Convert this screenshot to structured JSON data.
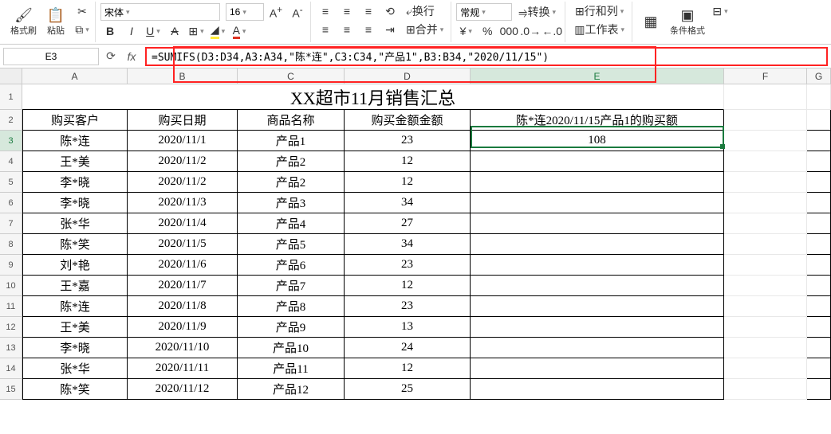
{
  "ribbon": {
    "format_painter": "格式刷",
    "paste": "粘贴",
    "font_name": "宋体",
    "font_size": "16",
    "wrap": "换行",
    "merge": "合并",
    "number_fmt": "常规",
    "convert": "转换",
    "rows_cols": "行和列",
    "worksheet": "工作表",
    "cond_fmt": "条件格式"
  },
  "formula_bar": {
    "cell_ref": "E3",
    "formula": "=SUMIFS(D3:D34,A3:A34,\"陈*连\",C3:C34,\"产品1\",B3:B34,\"2020/11/15\")"
  },
  "columns": [
    "A",
    "B",
    "C",
    "D",
    "E",
    "F",
    "G"
  ],
  "title": "XX超市11月销售汇总",
  "headers": [
    "购买客户",
    "购买日期",
    "商品名称",
    "购买金额金额",
    "陈*连2020/11/15产品1的购买额"
  ],
  "rows": [
    {
      "r": "1"
    },
    {
      "r": "2"
    },
    {
      "r": "3",
      "a": "陈*连",
      "b": "2020/11/1",
      "c": "产品1",
      "d": "23",
      "e": "108"
    },
    {
      "r": "4",
      "a": "王*美",
      "b": "2020/11/2",
      "c": "产品2",
      "d": "12",
      "e": ""
    },
    {
      "r": "5",
      "a": "李*晓",
      "b": "2020/11/2",
      "c": "产品2",
      "d": "12",
      "e": ""
    },
    {
      "r": "6",
      "a": "李*晓",
      "b": "2020/11/3",
      "c": "产品3",
      "d": "34",
      "e": ""
    },
    {
      "r": "7",
      "a": "张*华",
      "b": "2020/11/4",
      "c": "产品4",
      "d": "27",
      "e": ""
    },
    {
      "r": "8",
      "a": "陈*笑",
      "b": "2020/11/5",
      "c": "产品5",
      "d": "34",
      "e": ""
    },
    {
      "r": "9",
      "a": "刘*艳",
      "b": "2020/11/6",
      "c": "产品6",
      "d": "23",
      "e": ""
    },
    {
      "r": "10",
      "a": "王*嘉",
      "b": "2020/11/7",
      "c": "产品7",
      "d": "12",
      "e": ""
    },
    {
      "r": "11",
      "a": "陈*连",
      "b": "2020/11/8",
      "c": "产品8",
      "d": "23",
      "e": ""
    },
    {
      "r": "12",
      "a": "王*美",
      "b": "2020/11/9",
      "c": "产品9",
      "d": "13",
      "e": ""
    },
    {
      "r": "13",
      "a": "李*晓",
      "b": "2020/11/10",
      "c": "产品10",
      "d": "24",
      "e": ""
    },
    {
      "r": "14",
      "a": "张*华",
      "b": "2020/11/11",
      "c": "产品11",
      "d": "12",
      "e": ""
    },
    {
      "r": "15",
      "a": "陈*笑",
      "b": "2020/11/12",
      "c": "产品12",
      "d": "25",
      "e": ""
    }
  ],
  "chart_data": {
    "type": "table",
    "title": "XX超市11月销售汇总",
    "columns": [
      "购买客户",
      "购买日期",
      "商品名称",
      "购买金额金额",
      "陈*连2020/11/15产品1的购买额"
    ],
    "data": [
      [
        "陈*连",
        "2020/11/1",
        "产品1",
        23,
        108
      ],
      [
        "王*美",
        "2020/11/2",
        "产品2",
        12,
        null
      ],
      [
        "李*晓",
        "2020/11/2",
        "产品2",
        12,
        null
      ],
      [
        "李*晓",
        "2020/11/3",
        "产品3",
        34,
        null
      ],
      [
        "张*华",
        "2020/11/4",
        "产品4",
        27,
        null
      ],
      [
        "陈*笑",
        "2020/11/5",
        "产品5",
        34,
        null
      ],
      [
        "刘*艳",
        "2020/11/6",
        "产品6",
        23,
        null
      ],
      [
        "王*嘉",
        "2020/11/7",
        "产品7",
        12,
        null
      ],
      [
        "陈*连",
        "2020/11/8",
        "产品8",
        23,
        null
      ],
      [
        "王*美",
        "2020/11/9",
        "产品9",
        13,
        null
      ],
      [
        "李*晓",
        "2020/11/10",
        "产品10",
        24,
        null
      ],
      [
        "张*华",
        "2020/11/11",
        "产品11",
        12,
        null
      ],
      [
        "陈*笑",
        "2020/11/12",
        "产品12",
        25,
        null
      ]
    ]
  }
}
